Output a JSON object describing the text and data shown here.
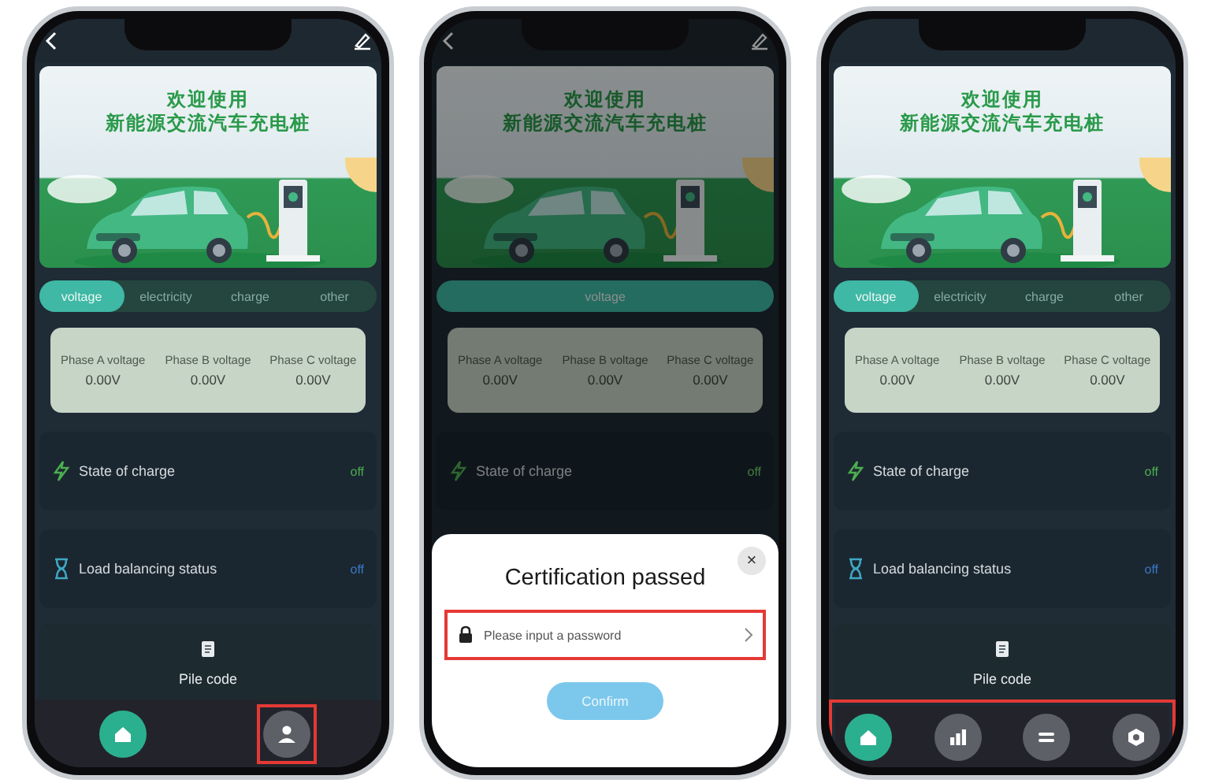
{
  "phones": [
    {
      "back_button": true,
      "edit_button": true,
      "banner": {
        "line_1": "欢迎使用",
        "line_2": "新能源交流汽车充电桩"
      },
      "tabs": [
        {
          "label": "voltage",
          "selected": true
        },
        {
          "label": "electricity",
          "selected": false
        },
        {
          "label": "charge",
          "selected": false
        },
        {
          "label": "other",
          "selected": false
        }
      ],
      "phases": [
        {
          "label": "Phase A voltage",
          "value": "0.00V"
        },
        {
          "label": "Phase B voltage",
          "value": "0.00V"
        },
        {
          "label": "Phase C voltage",
          "value": "0.00V"
        }
      ],
      "status_rows": [
        {
          "kind": "bolt",
          "label": "State of charge",
          "value": "off",
          "color": "#4caf50"
        },
        {
          "kind": "hourglass",
          "label": "Load balancing status",
          "value": "off",
          "color": "#3a78c8"
        }
      ],
      "pile_code": "Pile code",
      "nav_highlighted": false,
      "nav": [
        {
          "kind": "home",
          "selected": true,
          "highlighted": false
        },
        {
          "kind": "profile",
          "selected": false,
          "highlighted": true
        }
      ]
    },
    {
      "back_button": true,
      "edit_button": true,
      "banner": {
        "line_1": "欢迎使用",
        "line_2": "新能源交流汽车充电桩"
      },
      "tabs": [
        {
          "label": "voltage",
          "selected": true
        }
      ],
      "phases": [
        {
          "label": "Phase A voltage",
          "value": "0.00V"
        },
        {
          "label": "Phase B voltage",
          "value": "0.00V"
        },
        {
          "label": "Phase C voltage",
          "value": "0.00V"
        }
      ],
      "status_rows": [
        {
          "kind": "bolt",
          "label": "State of charge",
          "value": "off"
        }
      ],
      "dialog": {
        "close": "×",
        "title": "Certification passed",
        "placeholder": "Please input a password",
        "field_highlighted": true,
        "confirm": "Confirm"
      }
    },
    {
      "back_button": false,
      "edit_button": false,
      "banner": {
        "line_1": "欢迎使用",
        "line_2": "新能源交流汽车充电桩"
      },
      "tabs": [
        {
          "label": "voltage",
          "selected": true
        },
        {
          "label": "electricity",
          "selected": false
        },
        {
          "label": "charge",
          "selected": false
        },
        {
          "label": "other",
          "selected": false
        }
      ],
      "phases": [
        {
          "label": "Phase A voltage",
          "value": "0.00V"
        },
        {
          "label": "Phase B voltage",
          "value": "0.00V"
        },
        {
          "label": "Phase C voltage",
          "value": "0.00V"
        }
      ],
      "status_rows": [
        {
          "kind": "bolt",
          "label": "State of charge",
          "value": "off",
          "color": "#4caf50"
        },
        {
          "kind": "hourglass",
          "label": "Load balancing status",
          "value": "off",
          "color": "#3a78c8"
        }
      ],
      "pile_code": "Pile code",
      "nav_highlighted": true,
      "nav": [
        {
          "kind": "home",
          "selected": true,
          "highlighted": false
        },
        {
          "kind": "chart",
          "selected": false,
          "highlighted": false
        },
        {
          "kind": "equals",
          "selected": false,
          "highlighted": false
        },
        {
          "kind": "settings",
          "selected": false,
          "highlighted": false
        }
      ]
    }
  ]
}
